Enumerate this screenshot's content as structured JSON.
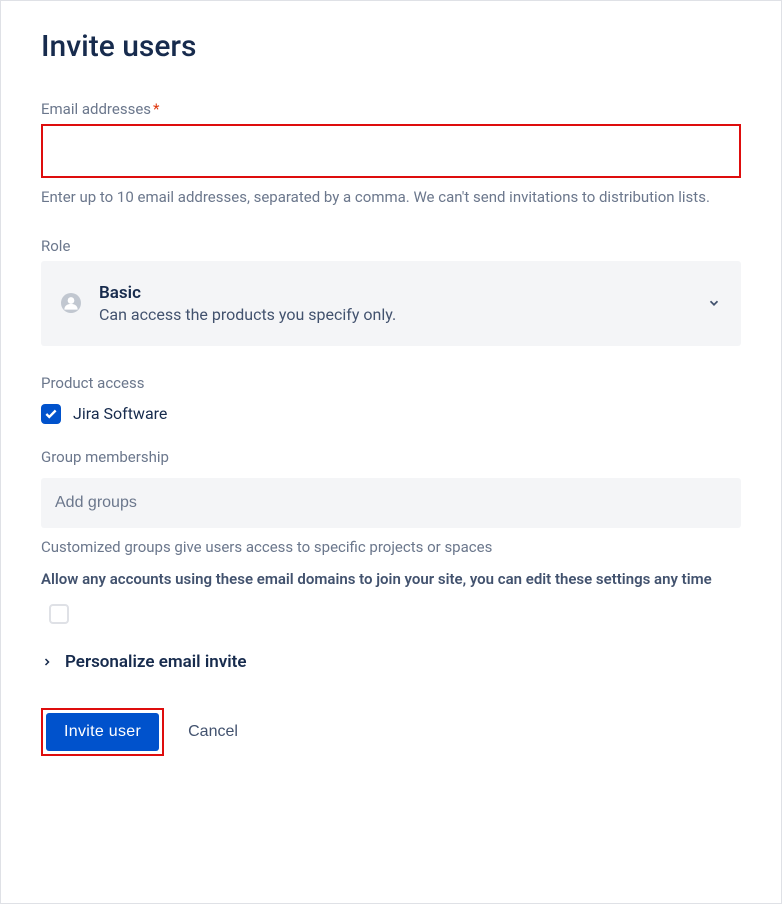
{
  "title": "Invite users",
  "email": {
    "label": "Email addresses",
    "required": "*",
    "value": "",
    "helper": "Enter up to 10 email addresses, separated by a comma. We can't send invitations to distribution lists."
  },
  "role": {
    "label": "Role",
    "selected_name": "Basic",
    "selected_desc": "Can access the products you specify only."
  },
  "product_access": {
    "label": "Product access",
    "items": [
      {
        "label": "Jira Software",
        "checked": true
      }
    ]
  },
  "groups": {
    "label": "Group membership",
    "placeholder": "Add groups",
    "helper": "Customized groups give users access to specific projects or spaces"
  },
  "domain_join": {
    "text": "Allow any accounts using these email domains to join your site, you can edit these settings any time",
    "checked": false
  },
  "personalize": {
    "label": "Personalize email invite"
  },
  "buttons": {
    "invite": "Invite   user",
    "cancel": "Cancel"
  }
}
